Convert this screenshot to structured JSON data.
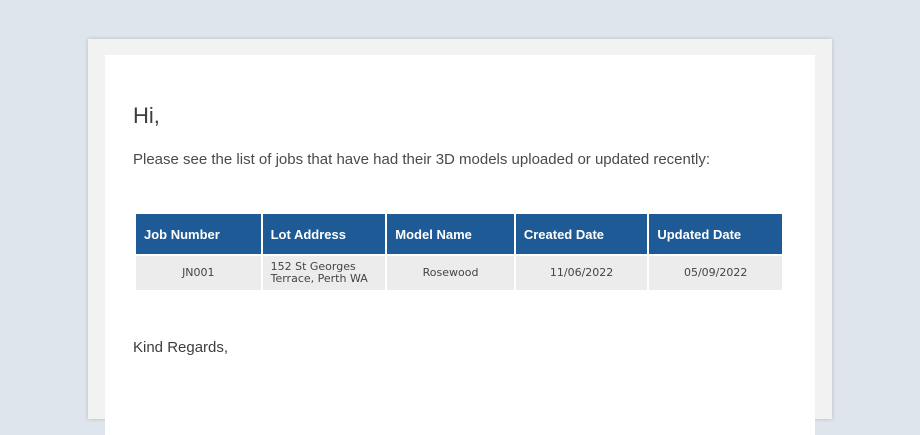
{
  "email": {
    "greeting": "Hi,",
    "intro": "Please see the list of jobs that have had their 3D models uploaded or updated recently:",
    "signoff": "Kind Regards,"
  },
  "table": {
    "headers": [
      "Job Number",
      "Lot Address",
      "Model Name",
      "Created Date",
      "Updated Date"
    ],
    "rows": [
      [
        "JN001",
        "152 St Georges Terrace, Perth WA",
        "Rosewood",
        "11/06/2022",
        "05/09/2022"
      ]
    ]
  },
  "colors": {
    "header_bg": "#1e5b96",
    "row_bg": "#ececec",
    "page_bg": "#dfe5ec"
  }
}
